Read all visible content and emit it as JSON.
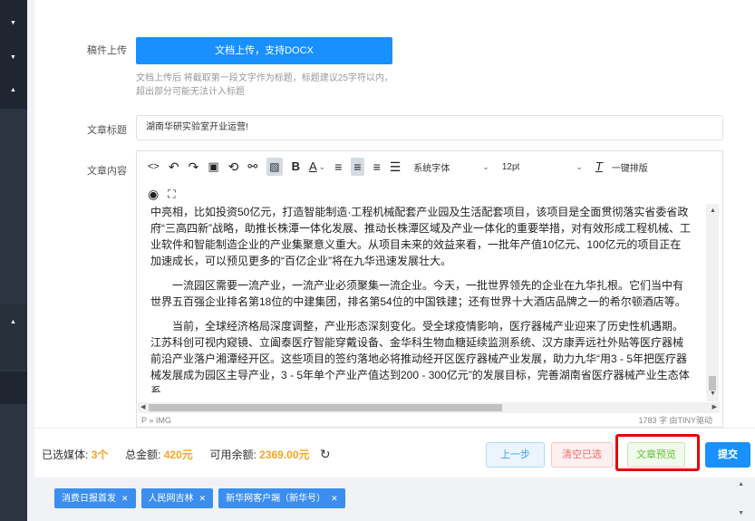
{
  "upload": {
    "label": "稿件上传",
    "button": "文档上传，支持DOCX",
    "hint": "文档上传后 将截取第一段文字作为标题，标题建议25字符以内，超出部分可能无法计入标题"
  },
  "title_field": {
    "label": "文章标题",
    "value": "湖南华研实验室开业运营!"
  },
  "content_field": {
    "label": "文章内容"
  },
  "toolbar": {
    "font_family": "系统字体",
    "font_size": "12pt",
    "one_click_layout": "一键排版"
  },
  "article": {
    "paragraphs": [
      "中亮相，比如投资50亿元，打造智能制造·工程机械配套产业园及生活配套项目，该项目是全面贯彻落实省委省政府“三高四新”战略，助推长株潭一体化发展、推动长株潭区域及产业一体化的重要举措，对有效形成工程机械、工业软件和智能制造企业的产业集聚意义重大。从项目未来的效益来看，一批年产值10亿元、100亿元的项目正在加速成长，可以预见更多的“百亿企业”将在九华迅速发展壮大。",
      "一流园区需要一流产业，一流产业必须聚集一流企业。今天，一批世界领先的企业在九华扎根。它们当中有世界五百强企业排名第18位的中建集团，排名第54位的中国铁建；还有世界十大酒店品牌之一的希尔顿酒店等。",
      "当前，全球经济格局深度调整，产业形态深刻变化。受全球疫情影响，医疗器械产业迎来了历史性机遇期。江苏科创可视内窥镜、立阖泰医疗智能穿戴设备、金华科生物血糖延续监测系统、汉方康弄远社外贴等医疗器械前沿产业落户湘潭经开区。这些项目的签约落地必将推动经开区医疗器械产业发展，助力九华“用3 - 5年把医疗器械发展成为园区主导产业，3 - 5年单个产业产值达到200 - 300亿元”的发展目标，完善湖南省医疗器械产业生态体系。"
    ]
  },
  "status": {
    "path": "P » IMG",
    "word_count": "1783 字 由TINY驱动"
  },
  "summary": {
    "media_label": "已选媒体:",
    "media_count": "3个",
    "total_label": "总金额:",
    "total_value": "420元",
    "balance_label": "可用余额:",
    "balance_value": "2369.00元"
  },
  "buttons": {
    "prev": "上一步",
    "clear": "清空已选",
    "preview": "文章预览",
    "submit": "提交"
  },
  "tags": [
    {
      "label": "消费日报首发"
    },
    {
      "label": "人民网吉林"
    },
    {
      "label": "新华网客户端（新华号）"
    }
  ],
  "colors": {
    "primary": "#1890ff",
    "highlight": "#e8000b",
    "amount": "#f5a623",
    "sidebar": "#2b3440"
  }
}
